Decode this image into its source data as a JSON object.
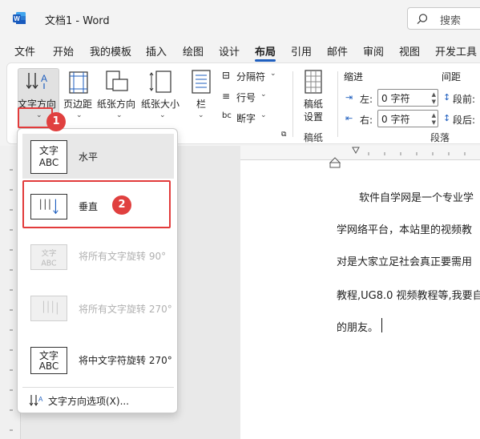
{
  "titlebar": {
    "doc_title": "文档1  -  Word",
    "search_label": "搜索"
  },
  "tabs": [
    "文件",
    "开始",
    "我的模板",
    "插入",
    "绘图",
    "设计",
    "布局",
    "引用",
    "邮件",
    "审阅",
    "视图",
    "开发工具"
  ],
  "active_tab": "布局",
  "ribbon": {
    "text_direction": "文字方向",
    "margins": "页边距",
    "orientation": "纸张方向",
    "size": "纸张大小",
    "columns": "栏",
    "breaks": "分隔符",
    "line_numbers": "行号",
    "hyphenation": "断字",
    "manuscript_settings_1": "稿纸",
    "manuscript_settings_2": "设置",
    "group_manuscript": "稿纸",
    "indent_title": "缩进",
    "spacing_title": "间距",
    "indent_left_label": "左:",
    "indent_left_value": "0 字符",
    "indent_right_label": "右:",
    "indent_right_value": "0 字符",
    "spacing_before_label": "段前:",
    "spacing_after_label": "段后:",
    "group_paragraph": "段落"
  },
  "dropdown": {
    "items": [
      {
        "label": "水平",
        "icon_text_1": "文字",
        "icon_text_2": "ABC"
      },
      {
        "label": "垂直"
      },
      {
        "label": "将所有文字旋转 90°"
      },
      {
        "label": "将所有文字旋转 270°"
      },
      {
        "label": "将中文字符旋转 270°",
        "icon_text_1": "文字",
        "icon_text_2": "ABC"
      }
    ],
    "options_label": "文字方向选项(X)..."
  },
  "document": {
    "lines": [
      "软件自学网是一个专业学",
      "学网络平台，本站里的视频教",
      "对是大家立足社会真正要需用",
      "教程,UG8.0  视频教程等,我要自",
      "的朋友。"
    ]
  },
  "badges": [
    "1",
    "2"
  ],
  "colors": {
    "accent": "#1f5fbf",
    "highlight": "#e23b3b",
    "word_blue": "#185abd"
  }
}
